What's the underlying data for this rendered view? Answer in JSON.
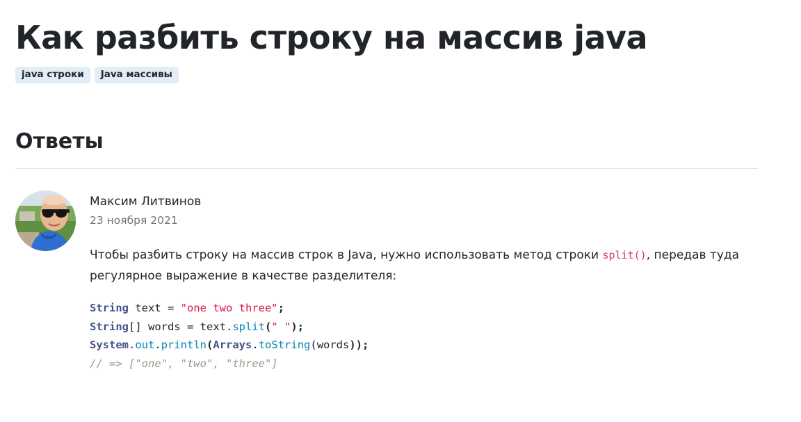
{
  "page": {
    "title": "Как разбить строку на массив java",
    "tags": [
      "java строки",
      "Java массивы"
    ]
  },
  "answers": {
    "heading": "Ответы",
    "items": [
      {
        "author": "Максим Литвинов",
        "date": "23 ноября 2021",
        "text_before": "Чтобы разбить строку на массив строк в Java, нужно использовать метод строки ",
        "inline_code": "split()",
        "text_after": ", передав туда регулярное выражение в качестве разделителя:",
        "code": {
          "l1_type": "String",
          "l1_rest": " text = ",
          "l1_str": "\"one two three\"",
          "l1_end": ";",
          "l2_type": "String",
          "l2_rest": "[] words = text.",
          "l2_func": "split",
          "l2_open": "(",
          "l2_str": "\" \"",
          "l2_end": ");",
          "l3_type": "System",
          "l3_dot1": ".",
          "l3_prop": "out",
          "l3_dot2": ".",
          "l3_func": "println",
          "l3_open": "(",
          "l3_type2": "Arrays",
          "l3_dot3": ".",
          "l3_func2": "toString",
          "l3_args": "(words",
          "l3_end": "));",
          "l4_comment": "// => [\"one\", \"two\", \"three\"]"
        }
      }
    ]
  },
  "colors": {
    "tag_bg": "#e2edf8",
    "inline_code": "#d63384",
    "code_type": "#445588",
    "code_string": "#dd1144",
    "code_func": "#0086b3",
    "code_comment": "#999988"
  }
}
